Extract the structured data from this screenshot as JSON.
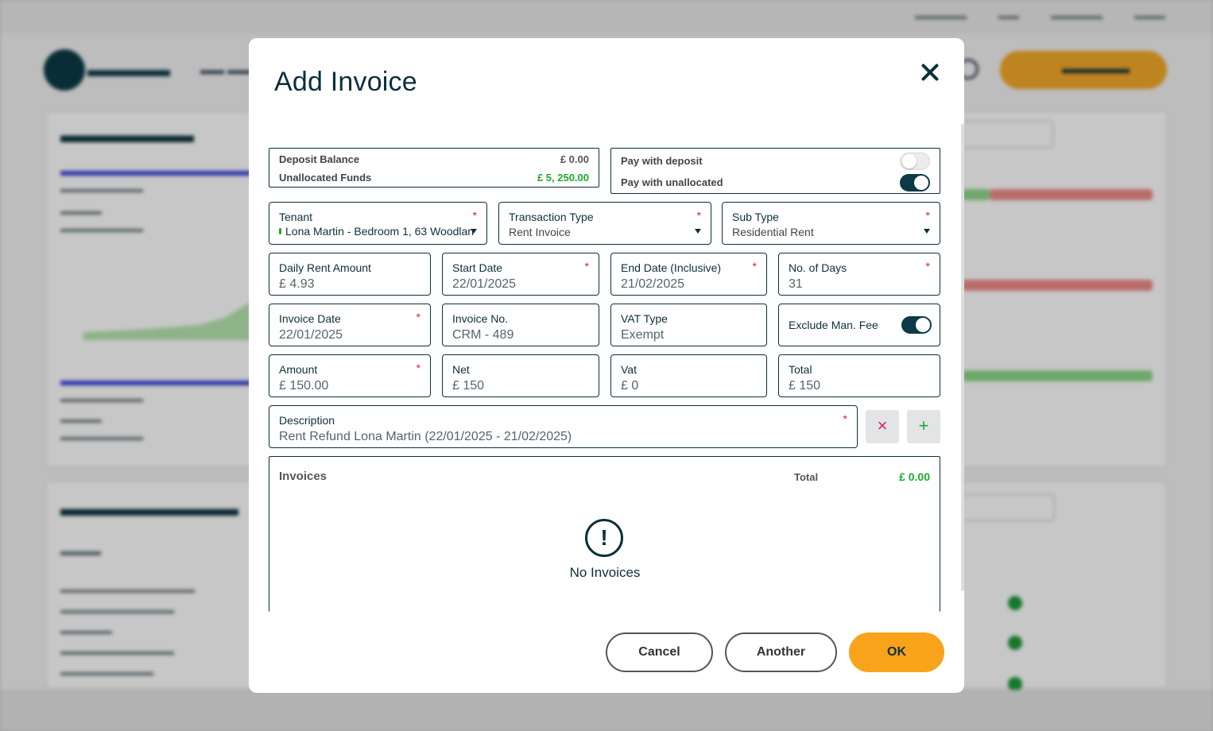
{
  "modal": {
    "title": "Add Invoice",
    "balances": {
      "deposit_label": "Deposit Balance",
      "deposit_value": "£ 0.00",
      "unallocated_label": "Unallocated Funds",
      "unallocated_value": "£ 5, 250.00"
    },
    "pay": {
      "deposit_label": "Pay with deposit",
      "deposit_on": false,
      "unallocated_label": "Pay with unallocated",
      "unallocated_on": true
    },
    "fields": {
      "tenant": {
        "label": "Tenant",
        "value": "Lona Martin - Bedroom 1, 63 Woodlan"
      },
      "transaction_type": {
        "label": "Transaction Type",
        "value": "Rent Invoice"
      },
      "sub_type": {
        "label": "Sub Type",
        "value": "Residential Rent"
      },
      "daily_rent": {
        "label": "Daily Rent Amount",
        "value": "£ 4.93"
      },
      "start_date": {
        "label": "Start Date",
        "value": "22/01/2025"
      },
      "end_date": {
        "label": "End Date (Inclusive)",
        "value": "21/02/2025"
      },
      "days": {
        "label": "No. of Days",
        "value": "31"
      },
      "invoice_date": {
        "label": "Invoice Date",
        "value": "22/01/2025"
      },
      "invoice_no": {
        "label": "Invoice No.",
        "value": "CRM - 489"
      },
      "vat_type": {
        "label": "VAT Type",
        "value": "Exempt"
      },
      "exclude_fee": {
        "label": "Exclude Man. Fee",
        "on": true
      },
      "amount": {
        "label": "Amount",
        "value": "£ 150.00"
      },
      "net": {
        "label": "Net",
        "value": "£ 150"
      },
      "vat": {
        "label": "Vat",
        "value": "£ 0"
      },
      "total": {
        "label": "Total",
        "value": "£ 150"
      },
      "description": {
        "label": "Description",
        "value": "Rent Refund Lona Martin (22/01/2025 - 21/02/2025)"
      }
    },
    "required_mark": "*",
    "invoices": {
      "title": "Invoices",
      "total_label": "Total",
      "total_value": "£ 0.00",
      "empty_icon": "!",
      "empty_text": "No Invoices"
    },
    "buttons": {
      "cancel": "Cancel",
      "another": "Another",
      "ok": "OK",
      "remove": "×",
      "add": "+"
    }
  },
  "colors": {
    "primary": "#0c2f3b",
    "accent": "#f8a31a",
    "required": "#d8203a",
    "positive": "#1ea82e"
  },
  "icons": {
    "close": "close-icon",
    "remove": "times-icon",
    "add": "plus-icon",
    "empty": "exclamation-circle-icon",
    "dropdown": "caret-down-icon"
  }
}
